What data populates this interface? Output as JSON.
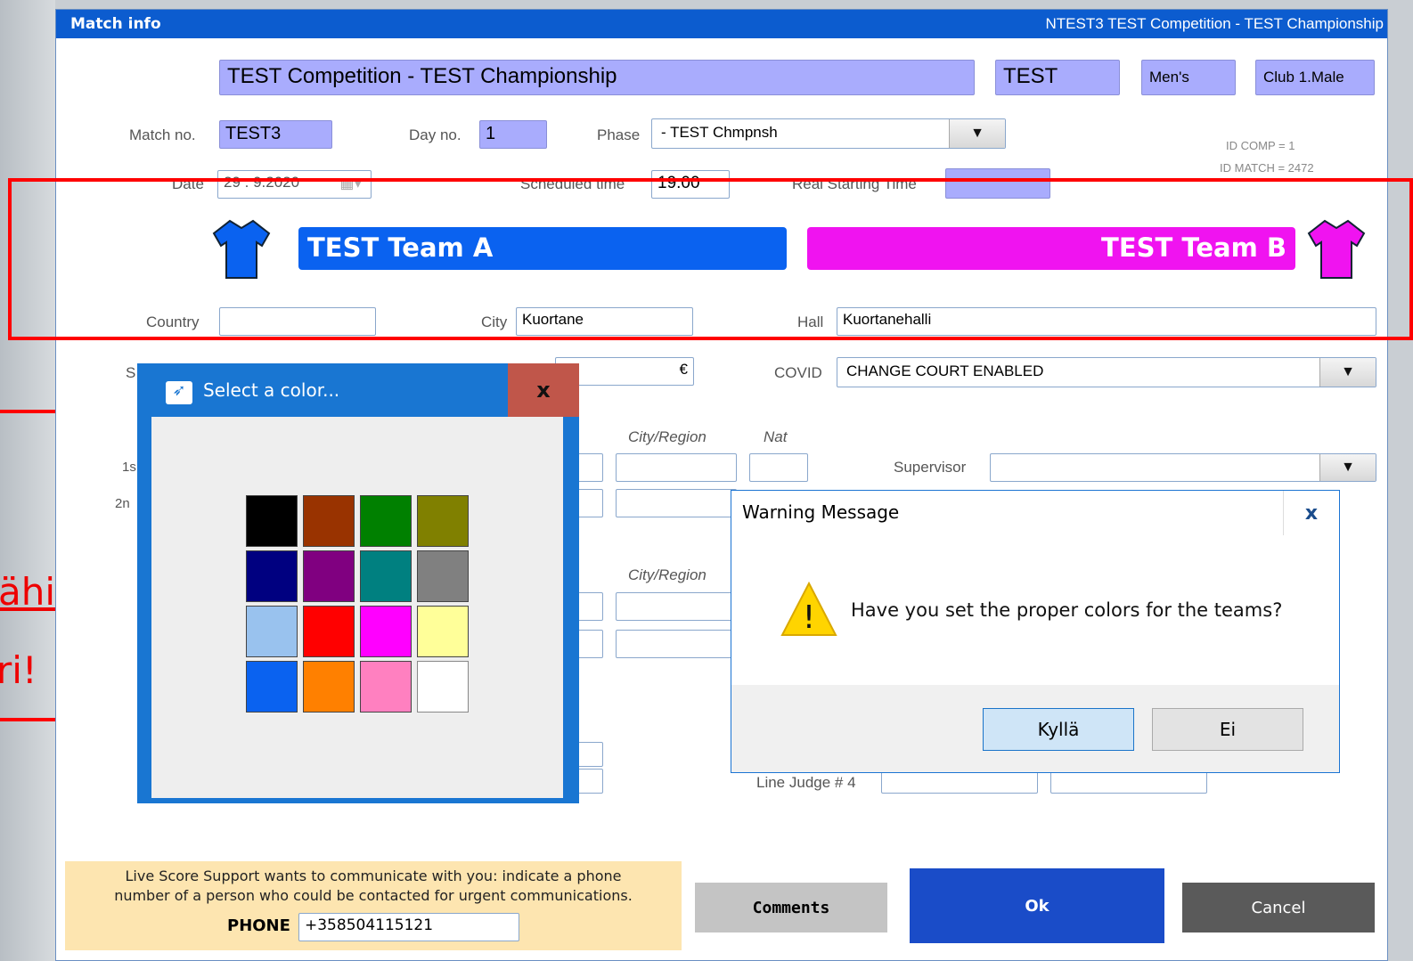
{
  "window": {
    "title": "Match info",
    "title_right": "NTEST3  TEST Competition - TEST Championship"
  },
  "header": {
    "competition": "TEST Competition - TEST Championship",
    "code": "TEST",
    "gender": "Men's",
    "category": "Club 1.Male"
  },
  "match": {
    "match_no_label": "Match no.",
    "match_no": "TEST3",
    "day_no_label": "Day no.",
    "day_no": "1",
    "phase_label": "Phase",
    "phase": "- TEST Chmpnsh",
    "id_comp": "ID COMP = 1",
    "id_match": "ID MATCH = 2472",
    "date_label": "Date",
    "date": "29 . 9.2020",
    "scheduled_label": "Scheduled time",
    "scheduled": "19.00",
    "real_start_label": "Real Starting Time",
    "real_start": ""
  },
  "teams": {
    "a": {
      "name": "TEST Team A",
      "color": "#0a62f0"
    },
    "b": {
      "name": "TEST Team B",
      "color": "#f013f0"
    }
  },
  "location": {
    "country_label": "Country",
    "country": "",
    "city_label": "City",
    "city": "Kuortane",
    "hall_label": "Hall",
    "hall": "Kuortanehalli"
  },
  "misc": {
    "s_label": "S",
    "euro": "€",
    "covid_label": "COVID",
    "covid": "CHANGE COURT ENABLED",
    "city_region": "City/Region",
    "nat": "Nat",
    "supervisor_label": "Supervisor",
    "first": "1s",
    "second": "2n",
    "city_region2": "City/Region",
    "line_judge4": "Line Judge # 4"
  },
  "side_text": {
    "line1": "ähin",
    "line2": "ri!"
  },
  "color_dialog": {
    "title": "Select a color...",
    "close": "x",
    "swatches": [
      "#000000",
      "#993300",
      "#008000",
      "#808000",
      "#000080",
      "#800080",
      "#008080",
      "#808080",
      "#99c2ee",
      "#ff0000",
      "#ff00ff",
      "#ffff99",
      "#0a62f0",
      "#ff8000",
      "#ff80c0",
      "#ffffff"
    ]
  },
  "warning": {
    "title": "Warning Message",
    "close": "x",
    "message": "Have you set the proper colors for the teams?",
    "yes": "Kyllä",
    "no": "Ei"
  },
  "live_score": {
    "text1": "Live Score Support wants to communicate with you: indicate a phone",
    "text2": "number of a person who could be contacted for urgent communications.",
    "phone_label": "PHONE",
    "phone": "+358504115121"
  },
  "buttons": {
    "comments": "Comments",
    "ok": "Ok",
    "cancel": "Cancel"
  }
}
